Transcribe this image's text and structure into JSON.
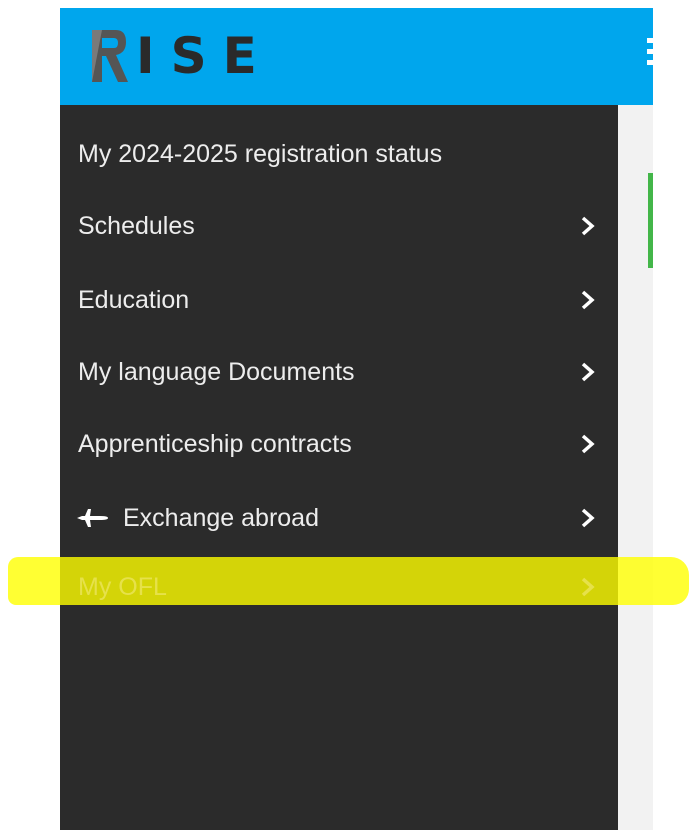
{
  "brand": {
    "name": "ISE",
    "color": "#00a6ed"
  },
  "sidebar": {
    "items": [
      {
        "label": "My 2024-2025 registration status",
        "icon": null,
        "has_chevron": false
      },
      {
        "label": "Schedules",
        "icon": null,
        "has_chevron": true
      },
      {
        "label": "Education",
        "icon": null,
        "has_chevron": true
      },
      {
        "label": "My language Documents",
        "icon": null,
        "has_chevron": true
      },
      {
        "label": "Apprenticeship contracts",
        "icon": null,
        "has_chevron": true
      },
      {
        "label": "Exchange abroad",
        "icon": "airplane-icon",
        "has_chevron": true
      },
      {
        "label": "My OFL",
        "icon": null,
        "has_chevron": true,
        "highlighted": true
      }
    ]
  },
  "colors": {
    "sidebar_bg": "#2b2b2b",
    "highlight": "#ffff00",
    "status_green": "#43b649"
  }
}
